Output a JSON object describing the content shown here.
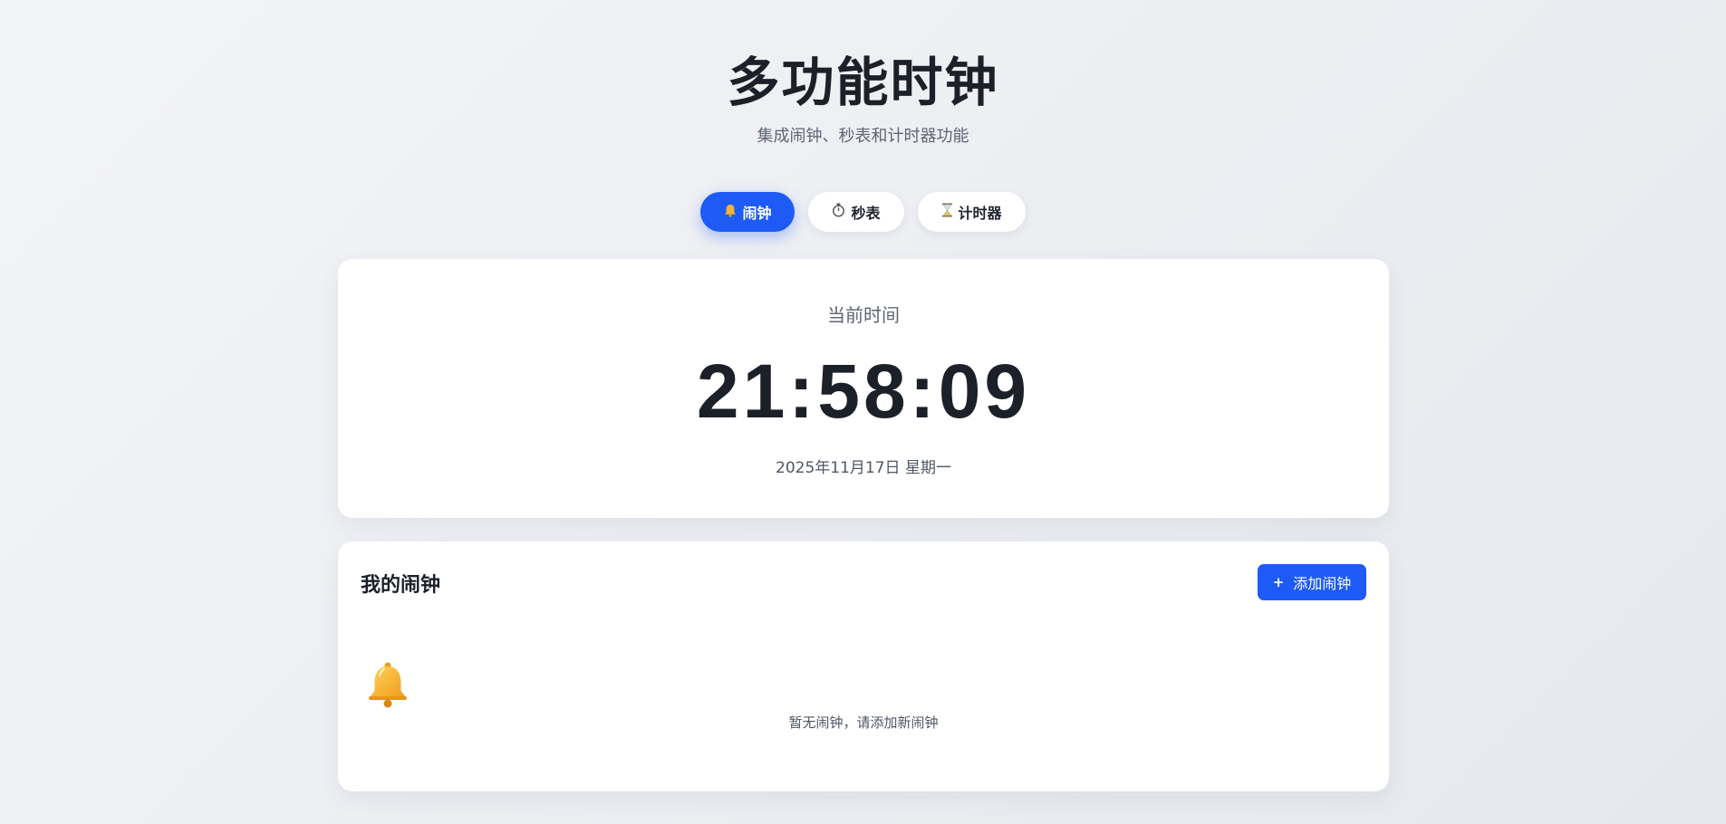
{
  "header": {
    "title": "多功能时钟",
    "subtitle": "集成闹钟、秒表和计时器功能"
  },
  "tabs": [
    {
      "icon": "bell-icon",
      "label": "闹钟",
      "active": true
    },
    {
      "icon": "stopwatch-icon",
      "label": "秒表",
      "active": false
    },
    {
      "icon": "hourglass-icon",
      "label": "计时器",
      "active": false
    }
  ],
  "clock": {
    "label": "当前时间",
    "time": "21:58:09",
    "date": "2025年11月17日 星期一"
  },
  "alarms": {
    "title": "我的闹钟",
    "add_label": "添加闹钟",
    "add_icon": "+",
    "empty_icon": "bell-icon",
    "empty_text": "暂无闹钟，请添加新闹钟"
  },
  "colors": {
    "accent": "#1e5bf6",
    "bell": "#f5b436"
  }
}
